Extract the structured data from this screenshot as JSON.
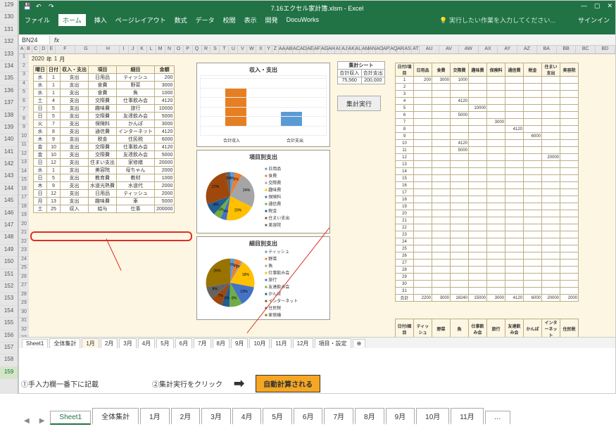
{
  "app": {
    "title": "7.16エクセル家計簿.xlsm - Excel",
    "namebox": "BN24",
    "signin": "サインイン",
    "tellme": "実行したい作業を入力してください..."
  },
  "menus": [
    "ファイル",
    "ホーム",
    "挿入",
    "ページレイアウト",
    "数式",
    "データ",
    "校閲",
    "表示",
    "開発",
    "DocuWorks"
  ],
  "outer_rows": [
    "129",
    "130",
    "131",
    "132",
    "133",
    "134",
    "135",
    "136",
    "137",
    "138",
    "139",
    "140",
    "141",
    "142",
    "143",
    "144",
    "145",
    "146",
    "147",
    "148",
    "149",
    "150",
    "151",
    "152",
    "153",
    "154",
    "155",
    "156",
    "157",
    "158",
    "159"
  ],
  "inner_cols": [
    "A",
    "B",
    "C",
    "D",
    "E",
    "F",
    "G",
    "H",
    "I",
    "J",
    "K",
    "L",
    "M",
    "N",
    "O",
    "P",
    "Q",
    "R",
    "S",
    "T",
    "U",
    "V",
    "W",
    "X",
    "Y",
    "Z",
    "AA",
    "AB",
    "AC",
    "AD",
    "AE",
    "AF",
    "AG",
    "AH",
    "AI",
    "AJ",
    "AK",
    "AL",
    "AM",
    "AN",
    "AO",
    "AP",
    "AQ",
    "AR",
    "AS",
    "AT",
    "AU",
    "AV",
    "AW",
    "AX",
    "AY",
    "AZ",
    "BA",
    "BB",
    "BC",
    "BD"
  ],
  "inner_rows_count": 33,
  "year": {
    "y": "2020",
    "yl": "年",
    "m": "1",
    "ml": "月"
  },
  "t1_head": [
    "曜日",
    "日付",
    "収入・支出",
    "項目",
    "細目",
    "金額"
  ],
  "t1_rows": [
    [
      "水",
      "1",
      "支出",
      "日用品",
      "ティッシュ",
      "200"
    ],
    [
      "水",
      "1",
      "支出",
      "食費",
      "野菜",
      "3000"
    ],
    [
      "水",
      "1",
      "支出",
      "食費",
      "魚",
      "1000"
    ],
    [
      "土",
      "4",
      "支出",
      "交際費",
      "仕事飲み会",
      "4120"
    ],
    [
      "日",
      "5",
      "支出",
      "趣味費",
      "旅行",
      "10000"
    ],
    [
      "日",
      "5",
      "支出",
      "交際費",
      "友達飲み会",
      "5000"
    ],
    [
      "火",
      "7",
      "支出",
      "保険料",
      "かんぽ",
      "3000"
    ],
    [
      "水",
      "8",
      "支出",
      "通信費",
      "インターネット",
      "4120"
    ],
    [
      "木",
      "9",
      "支出",
      "税金",
      "住民税",
      "6000"
    ],
    [
      "金",
      "10",
      "支出",
      "交際費",
      "仕事飲み会",
      "4120"
    ],
    [
      "金",
      "10",
      "支出",
      "交際費",
      "友達飲み会",
      "5000"
    ],
    [
      "日",
      "12",
      "支出",
      "住まい支出",
      "家修繕",
      "20000"
    ],
    [
      "水",
      "1",
      "支出",
      "美容院",
      "母ちゃん",
      "2000"
    ],
    [
      "日",
      "5",
      "支出",
      "教育費",
      "教材",
      "1000"
    ],
    [
      "木",
      "9",
      "支出",
      "水道光熱費",
      "水道代",
      "2000"
    ],
    [
      "日",
      "12",
      "支出",
      "日用品",
      "ティッシュ",
      "2000"
    ],
    [
      "月",
      "13",
      "支出",
      "趣味費",
      "車",
      "5000"
    ],
    [
      "土",
      "25",
      "収入",
      "給与",
      "仕事",
      "200000"
    ]
  ],
  "chart_data": [
    {
      "type": "bar",
      "title": "収入・支出",
      "ylim": [
        0,
        250000
      ],
      "categories": [
        "合計収入",
        "合計支出"
      ],
      "values": [
        200000,
        75560
      ],
      "colors": [
        "#e67e22",
        "#5b9bd5"
      ],
      "ticks": [
        0,
        50000,
        100000,
        150000,
        200000,
        250000
      ]
    },
    {
      "type": "pie",
      "title": "項目別支出",
      "series": [
        {
          "name": "日用品",
          "value": 3,
          "color": "#5b9bd5"
        },
        {
          "name": "食費",
          "value": 5,
          "color": "#ed7d31"
        },
        {
          "name": "交際費",
          "value": 24,
          "color": "#a5a5a5"
        },
        {
          "name": "趣味費",
          "value": 20,
          "color": "#ffc000"
        },
        {
          "name": "保険料",
          "value": 4,
          "color": "#4472c4"
        },
        {
          "name": "通信費",
          "value": 5,
          "color": "#70ad47"
        },
        {
          "name": "税金",
          "value": 8,
          "color": "#255e91"
        },
        {
          "name": "住まい支出",
          "value": 27,
          "color": "#9e480e"
        },
        {
          "name": "美容院",
          "value": 3,
          "color": "#636363"
        }
      ]
    },
    {
      "type": "pie",
      "title": "細目別支出",
      "series": [
        {
          "name": "ティッシュ",
          "value": 3,
          "color": "#5b9bd5"
        },
        {
          "name": "野菜",
          "value": 4,
          "color": "#ed7d31"
        },
        {
          "name": "魚",
          "value": 1,
          "color": "#a5a5a5"
        },
        {
          "name": "仕事飲み会",
          "value": 18,
          "color": "#ffc000"
        },
        {
          "name": "旅行",
          "value": 13,
          "color": "#4472c4"
        },
        {
          "name": "友達飲み会",
          "value": 8,
          "color": "#70ad47"
        },
        {
          "name": "かんぽ",
          "value": 5,
          "color": "#255e91"
        },
        {
          "name": "インターネット",
          "value": 7,
          "color": "#9e480e"
        },
        {
          "name": "住民税",
          "value": 8,
          "color": "#636363"
        },
        {
          "name": "家修繕",
          "value": 26,
          "color": "#997300"
        }
      ]
    }
  ],
  "summary": {
    "title": "集計シート",
    "h": [
      "合計収入",
      "合計支出"
    ],
    "v": [
      "75,560",
      "200,000"
    ]
  },
  "agg_btn": "集計実行",
  "t2_head": [
    "日付/項目",
    "日用品",
    "食費",
    "交際費",
    "趣味費",
    "保険料",
    "通信費",
    "税金",
    "住まい支出",
    "美容院"
  ],
  "t2_rows": [
    [
      "1",
      "200",
      "3000",
      "1000",
      "",
      "",
      "",
      "",
      "",
      ""
    ],
    [
      "2",
      "",
      "",
      "",
      "",
      "",
      "",
      "",
      "",
      ""
    ],
    [
      "3",
      "",
      "",
      "",
      "",
      "",
      "",
      "",
      "",
      ""
    ],
    [
      "4",
      "",
      "",
      "4120",
      "",
      "",
      "",
      "",
      "",
      ""
    ],
    [
      "5",
      "",
      "",
      "",
      "10000",
      "",
      "",
      "",
      "",
      ""
    ],
    [
      "6",
      "",
      "",
      "5000",
      "",
      "",
      "",
      "",
      "",
      ""
    ],
    [
      "7",
      "",
      "",
      "",
      "",
      "3000",
      "",
      "",
      "",
      ""
    ],
    [
      "8",
      "",
      "",
      "",
      "",
      "",
      "4120",
      "",
      "",
      ""
    ],
    [
      "9",
      "",
      "",
      "",
      "",
      "",
      "",
      "6000",
      "",
      ""
    ],
    [
      "10",
      "",
      "",
      "4120",
      "",
      "",
      "",
      "",
      "",
      ""
    ],
    [
      "11",
      "",
      "",
      "5000",
      "",
      "",
      "",
      "",
      "",
      ""
    ],
    [
      "12",
      "",
      "",
      "",
      "",
      "",
      "",
      "",
      "20000",
      ""
    ],
    [
      "13",
      "",
      "",
      "",
      "",
      "",
      "",
      "",
      "",
      ""
    ],
    [
      "14",
      "",
      "",
      "",
      "",
      "",
      "",
      "",
      "",
      ""
    ],
    [
      "15",
      "",
      "",
      "",
      "",
      "",
      "",
      "",
      "",
      ""
    ],
    [
      "16",
      "",
      "",
      "",
      "",
      "",
      "",
      "",
      "",
      ""
    ],
    [
      "17",
      "",
      "",
      "",
      "",
      "",
      "",
      "",
      "",
      ""
    ],
    [
      "18",
      "",
      "",
      "",
      "",
      "",
      "",
      "",
      "",
      ""
    ],
    [
      "19",
      "",
      "",
      "",
      "",
      "",
      "",
      "",
      "",
      ""
    ],
    [
      "20",
      "",
      "",
      "",
      "",
      "",
      "",
      "",
      "",
      ""
    ],
    [
      "21",
      "",
      "",
      "",
      "",
      "",
      "",
      "",
      "",
      ""
    ],
    [
      "22",
      "",
      "",
      "",
      "",
      "",
      "",
      "",
      "",
      ""
    ],
    [
      "23",
      "",
      "",
      "",
      "",
      "",
      "",
      "",
      "",
      ""
    ],
    [
      "24",
      "",
      "",
      "",
      "",
      "",
      "",
      "",
      "",
      ""
    ],
    [
      "25",
      "",
      "",
      "",
      "",
      "",
      "",
      "",
      "",
      ""
    ],
    [
      "26",
      "",
      "",
      "",
      "",
      "",
      "",
      "",
      "",
      ""
    ],
    [
      "27",
      "",
      "",
      "",
      "",
      "",
      "",
      "",
      "",
      ""
    ],
    [
      "28",
      "",
      "",
      "",
      "",
      "",
      "",
      "",
      "",
      ""
    ],
    [
      "29",
      "",
      "",
      "",
      "",
      "",
      "",
      "",
      "",
      ""
    ],
    [
      "30",
      "",
      "",
      "",
      "",
      "",
      "",
      "",
      "",
      ""
    ],
    [
      "31",
      "",
      "",
      "",
      "",
      "",
      "",
      "",
      "",
      ""
    ]
  ],
  "t2_foot": [
    "合計",
    "2200",
    "3000",
    "18240",
    "15000",
    "3000",
    "4120",
    "6000",
    "20000",
    "2000"
  ],
  "t3_head": [
    "日付/細目",
    "ティッシュ",
    "野菜",
    "魚",
    "仕事飲み会",
    "旅行",
    "友達飲み会",
    "かんぽ",
    "インターネット",
    "住民税"
  ],
  "inner_tabs": [
    "Sheet1",
    "全体集計",
    "1月",
    "2月",
    "3月",
    "4月",
    "5月",
    "6月",
    "7月",
    "8月",
    "9月",
    "10月",
    "11月",
    "12月",
    "項目・設定"
  ],
  "inner_tabs_active": 2,
  "outer_tabs": [
    "Sheet1",
    "全体集計",
    "1月",
    "2月",
    "3月",
    "4月",
    "5月",
    "6月",
    "7月",
    "8月",
    "9月",
    "10月",
    "11月"
  ],
  "outer_more": "…",
  "annot": {
    "a": "①手入力欄一番下に記載",
    "b": "②集計実行をクリック",
    "c": "自動計算される"
  }
}
